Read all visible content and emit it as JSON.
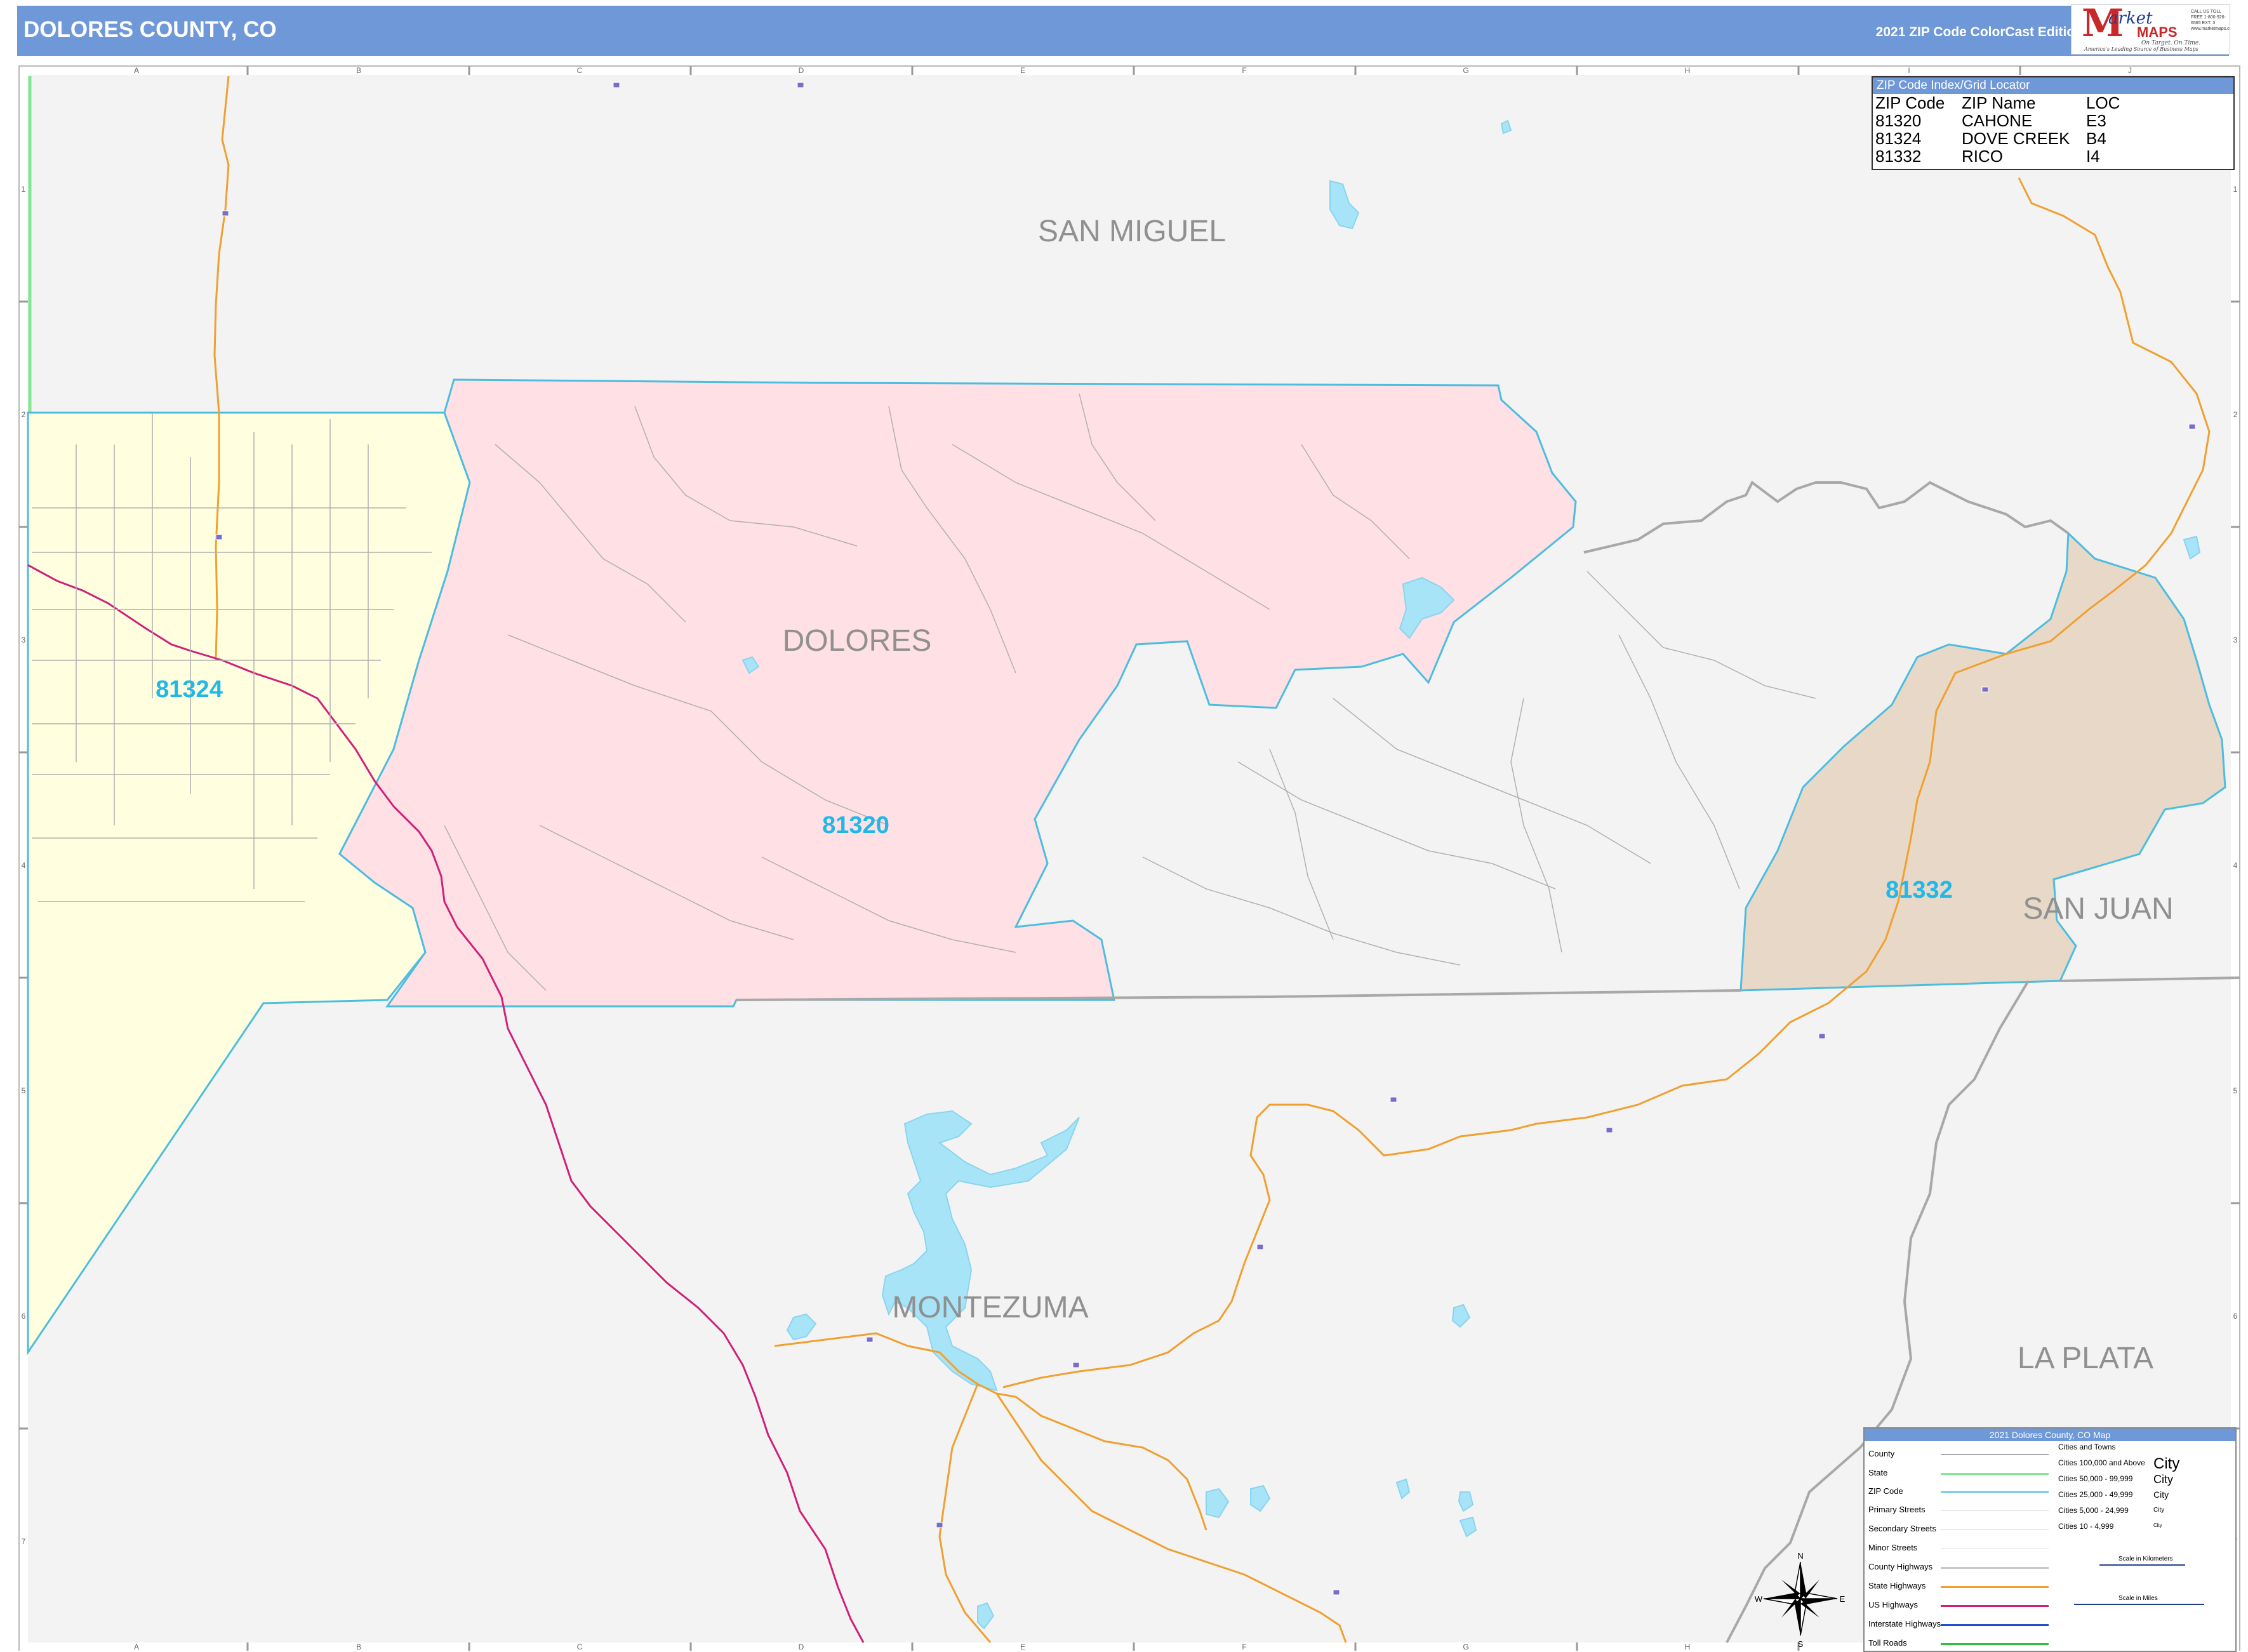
{
  "header": {
    "title": "DOLORES COUNTY, CO",
    "edition": "2021 ZIP Code ColorCast Edition"
  },
  "logo": {
    "letter": "M",
    "word1": "arket",
    "word2": "MAPS",
    "tagline": "On Target. On Time.",
    "subtitle": "America's Leading Source of Business Maps",
    "contact": "CALL US TOLL FREE 1-800-926-6565 EXT. 3 www.marketmaps.com"
  },
  "grid": {
    "columns": [
      "A",
      "B",
      "C",
      "D",
      "E",
      "F",
      "G",
      "H",
      "I",
      "J"
    ],
    "rows": [
      "1",
      "2",
      "3",
      "4",
      "5",
      "6",
      "7"
    ]
  },
  "counties": [
    "SAN MIGUEL",
    "DOLORES",
    "SAN JUAN",
    "MONTEZUMA",
    "LA PLATA"
  ],
  "zip_areas": [
    {
      "zip": "81324",
      "color": "#ffffe0"
    },
    {
      "zip": "81320",
      "color": "#ffe0e5"
    },
    {
      "zip": "81332",
      "color": "#e8d8c8"
    }
  ],
  "zip_index": {
    "title": "ZIP Code Index/Grid Locator",
    "headers": [
      "ZIP Code",
      "ZIP Name",
      "LOC"
    ],
    "rows": [
      [
        "81320",
        "CAHONE",
        "E3"
      ],
      [
        "81324",
        "DOVE CREEK",
        "B4"
      ],
      [
        "81332",
        "RICO",
        "I4"
      ]
    ]
  },
  "legend": {
    "title": "2021 Dolores County, CO Map",
    "items": [
      "County",
      "State",
      "ZIP Code",
      "Primary Streets",
      "Secondary Streets",
      "Minor Streets",
      "County Highways",
      "State Highways",
      "US Highways",
      "Interstate Highways",
      "Toll Roads"
    ],
    "cities_title": "Cities and Towns",
    "cities": [
      {
        "range": "Cities 100,000 and Above",
        "sample": "City"
      },
      {
        "range": "Cities 50,000 - 99,999",
        "sample": "City"
      },
      {
        "range": "Cities 25,000 - 49,999",
        "sample": "City"
      },
      {
        "range": "Cities 5,000 - 24,999",
        "sample": "City"
      },
      {
        "range": "Cities 10 - 4,999",
        "sample": "City"
      }
    ],
    "scale_km": "Scale in Kilometers",
    "scale_mi": "Scale in Miles"
  },
  "compass": {
    "n": "N",
    "s": "S",
    "e": "E",
    "w": "W"
  },
  "colors": {
    "header": "#6f98d8",
    "background": "#f3f3f3",
    "water": "#a8e4f8",
    "zip_border": "#4cbde0",
    "state_highway": "#f0a030",
    "us_highway": "#d0207a",
    "county_line": "#a0a0a0",
    "zip_label": "#20b8e8",
    "county_label": "#909090"
  }
}
